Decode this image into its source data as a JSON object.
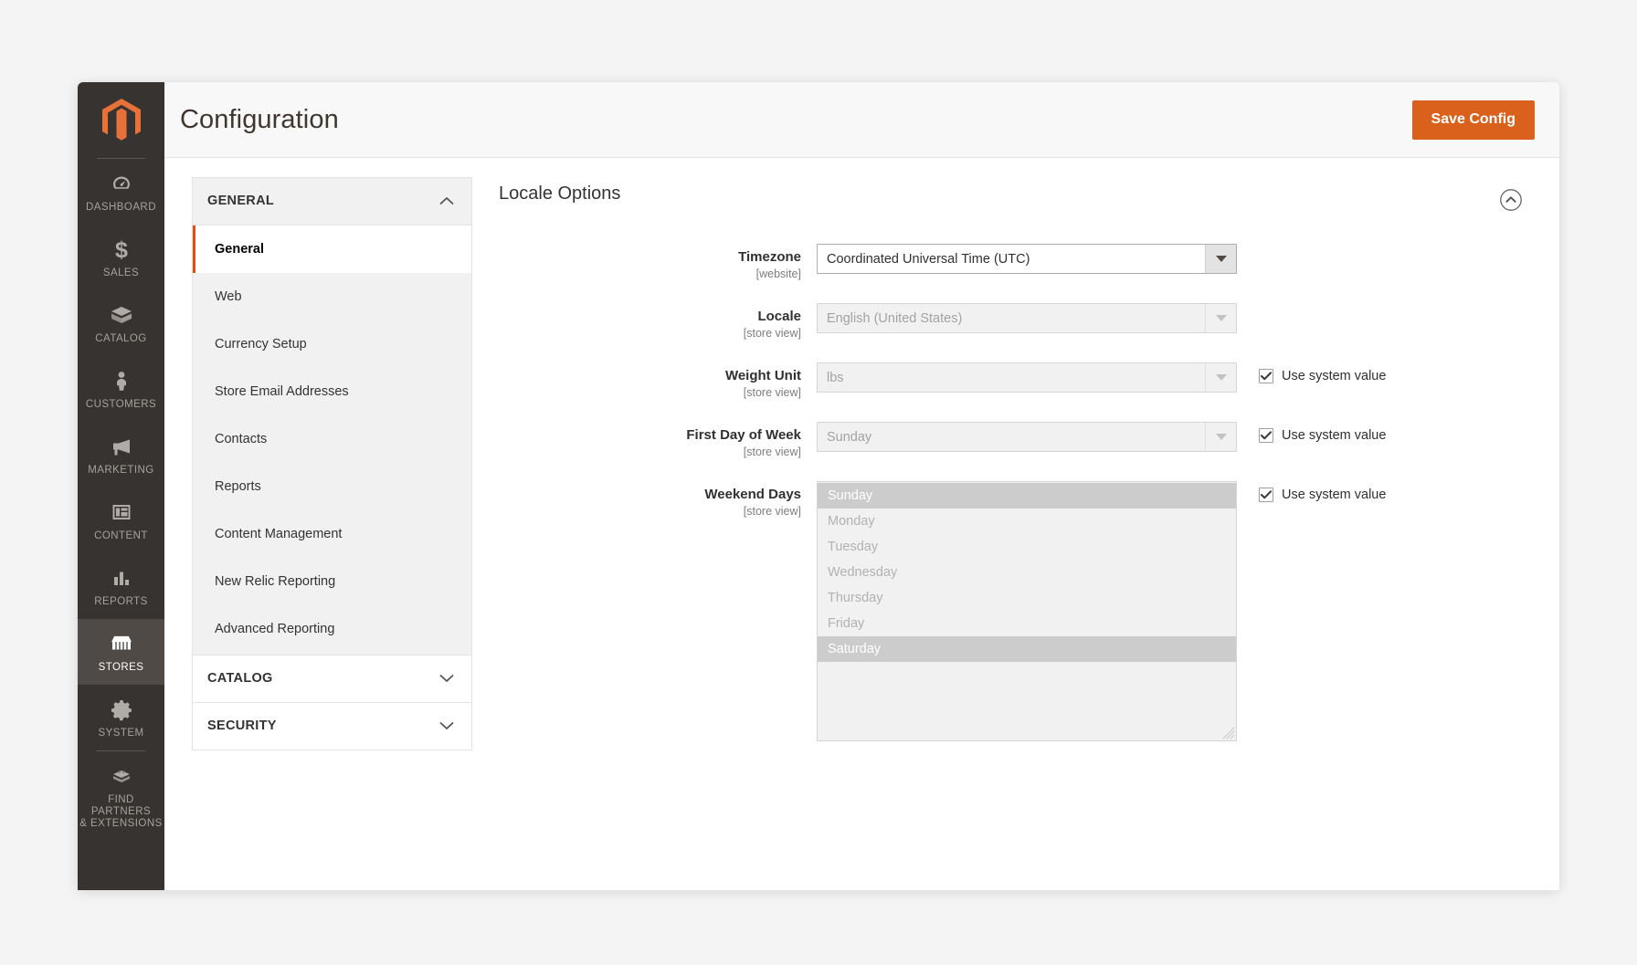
{
  "header": {
    "title": "Configuration",
    "save_label": "Save Config"
  },
  "nav_rail": {
    "logo": "magento-logo",
    "items": [
      {
        "label": "DASHBOARD",
        "icon": "dashboard-icon",
        "active": false
      },
      {
        "label": "SALES",
        "icon": "dollar-icon",
        "active": false
      },
      {
        "label": "CATALOG",
        "icon": "box-icon",
        "active": false
      },
      {
        "label": "CUSTOMERS",
        "icon": "person-icon",
        "active": false
      },
      {
        "label": "MARKETING",
        "icon": "megaphone-icon",
        "active": false
      },
      {
        "label": "CONTENT",
        "icon": "layout-icon",
        "active": false
      },
      {
        "label": "REPORTS",
        "icon": "bar-chart-icon",
        "active": false
      },
      {
        "label": "STORES",
        "icon": "storefront-icon",
        "active": true
      },
      {
        "label": "SYSTEM",
        "icon": "gear-icon",
        "active": false
      },
      {
        "label": "FIND PARTNERS\n& EXTENSIONS",
        "icon": "blocks-icon",
        "active": false
      }
    ]
  },
  "config_nav": {
    "sections": [
      {
        "title": "GENERAL",
        "expanded": true,
        "chevron": "chevron-up-icon",
        "items": [
          {
            "label": "General",
            "active": true
          },
          {
            "label": "Web",
            "active": false
          },
          {
            "label": "Currency Setup",
            "active": false
          },
          {
            "label": "Store Email Addresses",
            "active": false
          },
          {
            "label": "Contacts",
            "active": false
          },
          {
            "label": "Reports",
            "active": false
          },
          {
            "label": "Content Management",
            "active": false
          },
          {
            "label": "New Relic Reporting",
            "active": false
          },
          {
            "label": "Advanced Reporting",
            "active": false
          }
        ]
      },
      {
        "title": "CATALOG",
        "expanded": false,
        "chevron": "chevron-down-icon",
        "items": []
      },
      {
        "title": "SECURITY",
        "expanded": false,
        "chevron": "chevron-down-icon",
        "items": []
      }
    ]
  },
  "main": {
    "section_title": "Locale Options",
    "collapse_icon": "circle-chevron-up-icon",
    "system_value_label": "Use system value",
    "fields": [
      {
        "label": "Timezone",
        "scope": "[website]",
        "control": "select",
        "value": "Coordinated Universal Time (UTC)",
        "enabled": true,
        "system_value": null
      },
      {
        "label": "Locale",
        "scope": "[store view]",
        "control": "select",
        "value": "English (United States)",
        "enabled": false,
        "system_value": null
      },
      {
        "label": "Weight Unit",
        "scope": "[store view]",
        "control": "select",
        "value": "lbs",
        "enabled": false,
        "system_value": true
      },
      {
        "label": "First Day of Week",
        "scope": "[store view]",
        "control": "select",
        "value": "Sunday",
        "enabled": false,
        "system_value": true
      },
      {
        "label": "Weekend Days",
        "scope": "[store view]",
        "control": "multiselect",
        "options": [
          {
            "label": "Sunday",
            "selected": true
          },
          {
            "label": "Monday",
            "selected": false
          },
          {
            "label": "Tuesday",
            "selected": false
          },
          {
            "label": "Wednesday",
            "selected": false
          },
          {
            "label": "Thursday",
            "selected": false
          },
          {
            "label": "Friday",
            "selected": false
          },
          {
            "label": "Saturday",
            "selected": true
          }
        ],
        "system_value": true
      }
    ]
  },
  "colors": {
    "brand_orange": "#d9611c",
    "accent_orange": "#e04e15",
    "rail_bg": "#373330",
    "rail_active": "#4f4a46",
    "selected_option": "#cccccc"
  }
}
